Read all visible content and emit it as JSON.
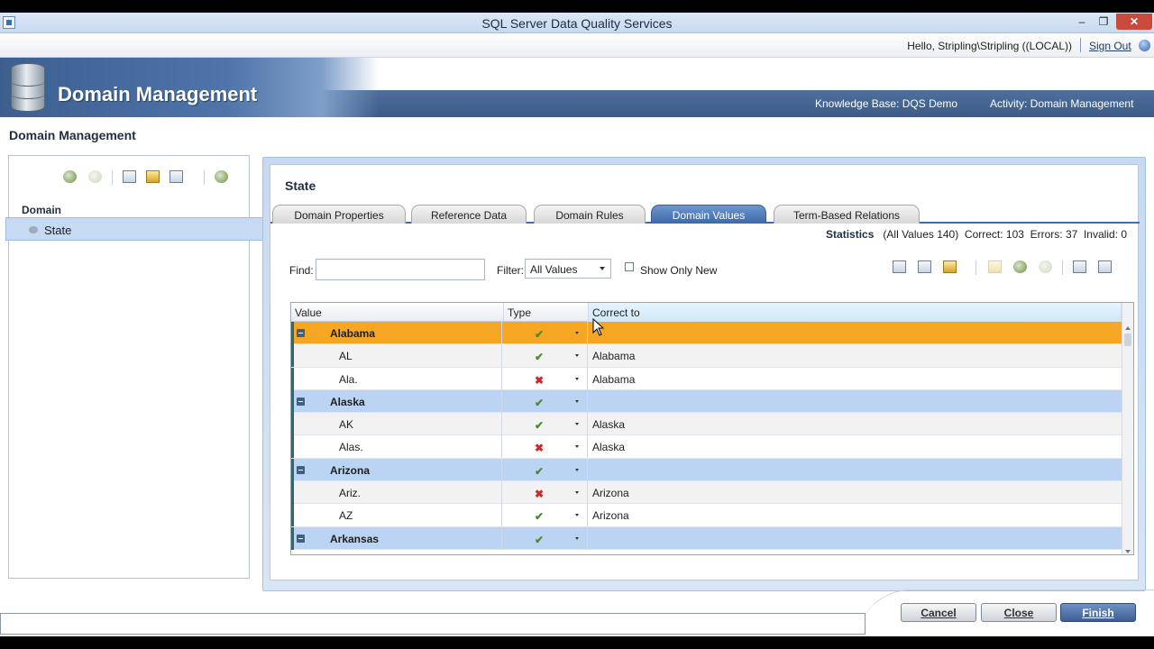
{
  "window": {
    "title": "SQL Server Data Quality Services",
    "minimize": "‒",
    "restore": "❐",
    "close": "✕"
  },
  "userbar": {
    "greeting": "Hello, Stripling\\Stripling ((LOCAL))",
    "sign_out": "Sign Out"
  },
  "banner": {
    "heading": "Domain Management",
    "knowledge_base": "Knowledge Base: DQS Demo",
    "activity": "Activity: Domain Management"
  },
  "page_title": "Domain Management",
  "left_panel": {
    "column_label": "Domain",
    "items": [
      {
        "label": "State"
      }
    ]
  },
  "right_panel": {
    "title": "State",
    "tabs": [
      {
        "label": "Domain Properties"
      },
      {
        "label": "Reference Data"
      },
      {
        "label": "Domain Rules"
      },
      {
        "label": "Domain Values",
        "active": true
      },
      {
        "label": "Term-Based Relations"
      }
    ],
    "statistics": {
      "label": "Statistics",
      "all": "(All Values 140)",
      "correct": "Correct: 103",
      "errors": "Errors: 37",
      "invalid": "Invalid: 0"
    },
    "find_label": "Find:",
    "find_value": "",
    "filter_label": "Filter:",
    "filter_value": "All Values",
    "show_only_new": "Show Only New",
    "grid": {
      "columns": [
        "Value",
        "Type",
        "Correct to"
      ],
      "rows": [
        {
          "value": "Alabama",
          "type": "correct",
          "correct_to": "",
          "group": true
        },
        {
          "value": "AL",
          "type": "correct",
          "correct_to": "Alabama",
          "group": false
        },
        {
          "value": "Ala.",
          "type": "error",
          "correct_to": "Alabama",
          "group": false
        },
        {
          "value": "Alaska",
          "type": "correct",
          "correct_to": "",
          "group": true
        },
        {
          "value": "AK",
          "type": "correct",
          "correct_to": "Alaska",
          "group": false
        },
        {
          "value": "Alas.",
          "type": "error",
          "correct_to": "Alaska",
          "group": false
        },
        {
          "value": "Arizona",
          "type": "correct",
          "correct_to": "",
          "group": true
        },
        {
          "value": "Ariz.",
          "type": "error",
          "correct_to": "Arizona",
          "group": false
        },
        {
          "value": "AZ",
          "type": "correct",
          "correct_to": "Arizona",
          "group": false
        },
        {
          "value": "Arkansas",
          "type": "correct",
          "correct_to": "",
          "group": true
        }
      ]
    }
  },
  "footer": {
    "cancel": "Cancel",
    "close": "Close",
    "finish": "Finish"
  },
  "icons": {
    "correct": "✔",
    "error": "✖"
  }
}
